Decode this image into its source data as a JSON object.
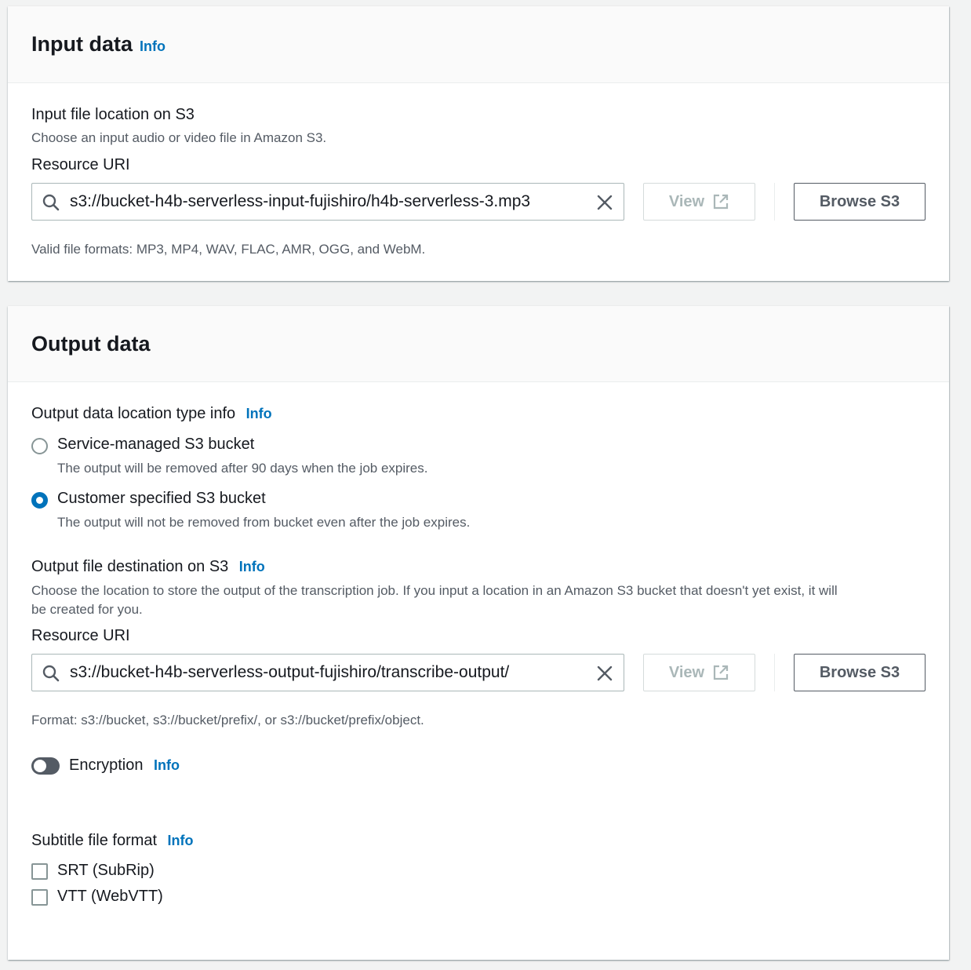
{
  "input_section": {
    "title": "Input data",
    "info": "Info",
    "file_label": "Input file location on S3",
    "file_desc": "Choose an input audio or video file in Amazon S3.",
    "uri_label": "Resource URI",
    "uri_value": "s3://bucket-h4b-serverless-input-fujishiro/h4b-serverless-3.mp3",
    "view_label": "View",
    "browse_label": "Browse S3",
    "hint": "Valid file formats: MP3, MP4, WAV, FLAC, AMR, OGG, and WebM."
  },
  "output_section": {
    "title": "Output data",
    "location_type_label": "Output data location type info",
    "location_type_info": "Info",
    "options": [
      {
        "label": "Service-managed S3 bucket",
        "desc": "The output will be removed after 90 days when the job expires.",
        "selected": false
      },
      {
        "label": "Customer specified S3 bucket",
        "desc": "The output will not be removed from bucket even after the job expires.",
        "selected": true
      }
    ],
    "destination_label": "Output file destination on S3",
    "destination_info": "Info",
    "destination_desc_line1": "Choose the location to store the output of the transcription job. If you input a location in an Amazon S3 bucket that doesn't yet exist, it will",
    "destination_desc_line2": "be created for you.",
    "uri_label": "Resource URI",
    "uri_value": "s3://bucket-h4b-serverless-output-fujishiro/transcribe-output/",
    "view_label": "View",
    "browse_label": "Browse S3",
    "format_hint": "Format: s3://bucket, s3://bucket/prefix/, or s3://bucket/prefix/object.",
    "encryption_label": "Encryption",
    "encryption_info": "Info",
    "encryption_enabled": false,
    "subtitle_label": "Subtitle file format",
    "subtitle_info": "Info",
    "subtitle_options": [
      {
        "label": "SRT (SubRip)",
        "checked": false
      },
      {
        "label": "VTT (WebVTT)",
        "checked": false
      }
    ]
  },
  "colors": {
    "link": "#0073bb",
    "radio_selected": "#0073bb",
    "toggle_off": "#545b64"
  }
}
